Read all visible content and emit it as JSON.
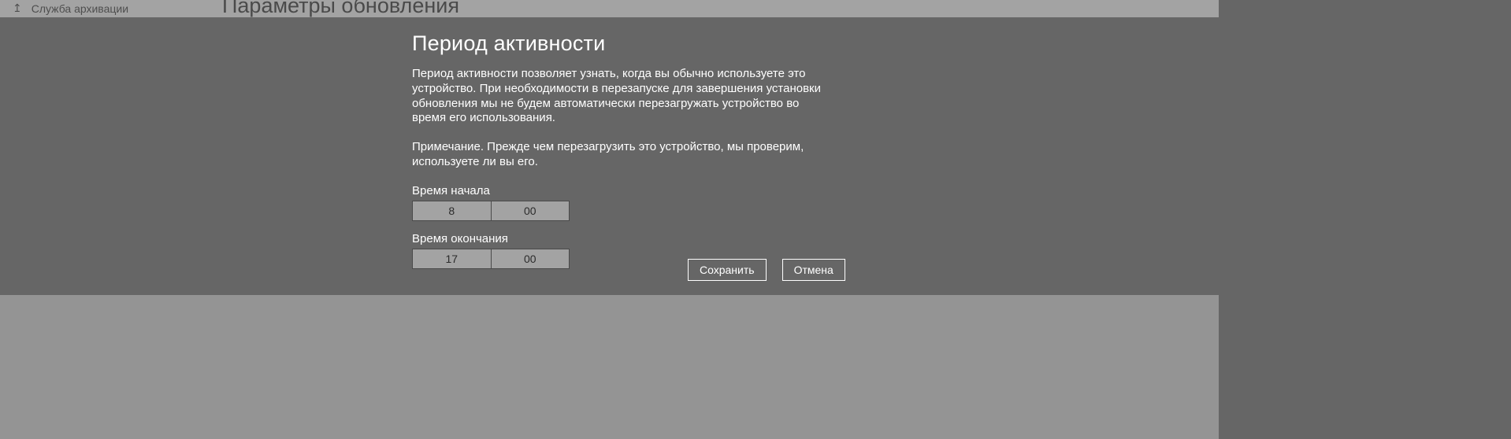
{
  "background": {
    "service_label": "Служба архивации",
    "heading": "Параметры обновления"
  },
  "modal": {
    "title": "Период активности",
    "description": "Период активности позволяет узнать, когда вы обычно используете это устройство. При необходимости в перезапуске для завершения установки обновления мы не будем автоматически перезагружать устройство во время его использования.",
    "note": "Примечание. Прежде чем перезагрузить это устройство, мы проверим, используете ли вы его.",
    "start_label": "Время начала",
    "end_label": "Время окончания",
    "start": {
      "hour": "8",
      "minute": "00"
    },
    "end": {
      "hour": "17",
      "minute": "00"
    },
    "save_label": "Сохранить",
    "cancel_label": "Отмена"
  }
}
